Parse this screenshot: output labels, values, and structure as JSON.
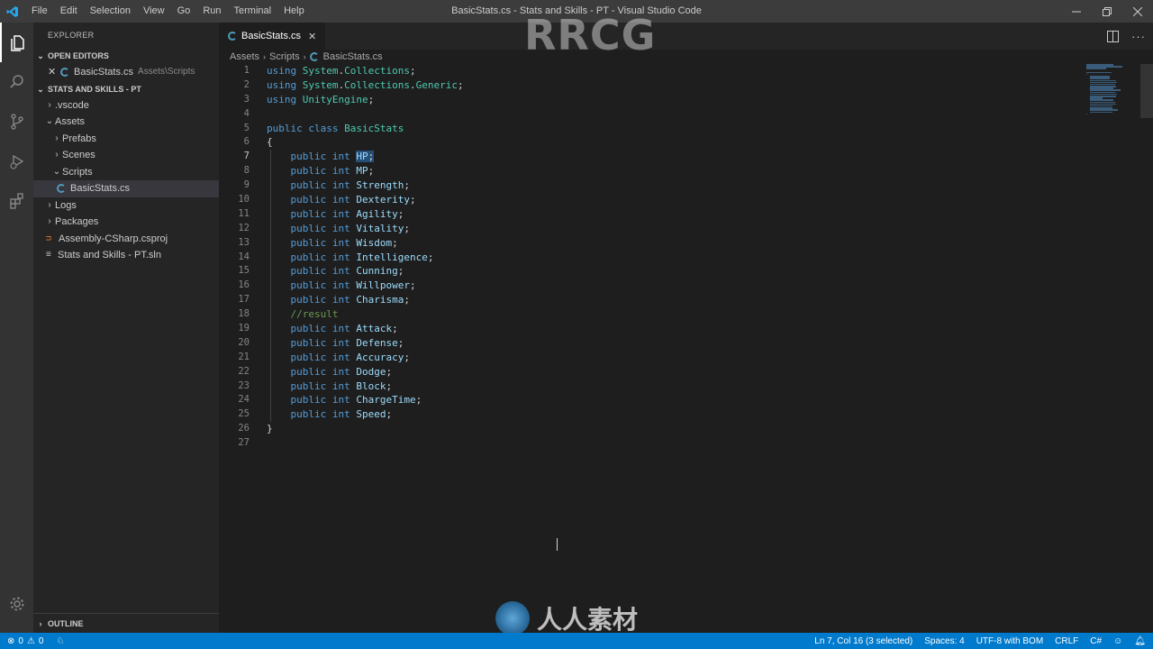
{
  "titlebar": {
    "menu": [
      "File",
      "Edit",
      "Selection",
      "View",
      "Go",
      "Run",
      "Terminal",
      "Help"
    ],
    "window_title": "BasicStats.cs - Stats and Skills - PT - Visual Studio Code"
  },
  "sidebar": {
    "title": "EXPLORER",
    "open_editors": {
      "label": "OPEN EDITORS",
      "items": [
        {
          "name": "BasicStats.cs",
          "path": "Assets\\Scripts"
        }
      ]
    },
    "workspace": {
      "label": "STATS AND SKILLS - PT",
      "tree": [
        {
          "label": ".vscode",
          "expanded": false
        },
        {
          "label": "Assets",
          "expanded": true
        },
        {
          "label": "Prefabs",
          "expanded": false
        },
        {
          "label": "Scenes",
          "expanded": false
        },
        {
          "label": "Scripts",
          "expanded": true
        },
        {
          "label": "BasicStats.cs",
          "selected": true
        },
        {
          "label": "Logs",
          "expanded": false
        },
        {
          "label": "Packages",
          "expanded": false
        },
        {
          "label": "Assembly-CSharp.csproj"
        },
        {
          "label": "Stats and Skills - PT.sln"
        }
      ]
    },
    "outline_label": "OUTLINE"
  },
  "editor": {
    "tab_label": "BasicStats.cs",
    "breadcrumb": [
      "Assets",
      "Scripts",
      "BasicStats.cs"
    ],
    "lines": [
      "using System.Collections;",
      "using System.Collections.Generic;",
      "using UnityEngine;",
      "",
      "public class BasicStats",
      "{",
      "    public int HP;",
      "    public int MP;",
      "    public int Strength;",
      "    public int Dexterity;",
      "    public int Agility;",
      "    public int Vitality;",
      "    public int Wisdom;",
      "    public int Intelligence;",
      "    public int Cunning;",
      "    public int Willpower;",
      "    public int Charisma;",
      "    //result",
      "    public int Attack;",
      "    public int Defense;",
      "    public int Accuracy;",
      "    public int Dodge;",
      "    public int Block;",
      "    public int ChargeTime;",
      "    public int Speed;",
      "}",
      ""
    ],
    "current_line": 7
  },
  "statusbar": {
    "errors": "0",
    "warnings": "0",
    "position": "Ln 7, Col 16 (3 selected)",
    "spaces": "Spaces: 4",
    "encoding": "UTF-8 with BOM",
    "eol": "CRLF",
    "language": "C#"
  },
  "watermark": {
    "top": "RRCG",
    "bottom": "人人素材"
  }
}
